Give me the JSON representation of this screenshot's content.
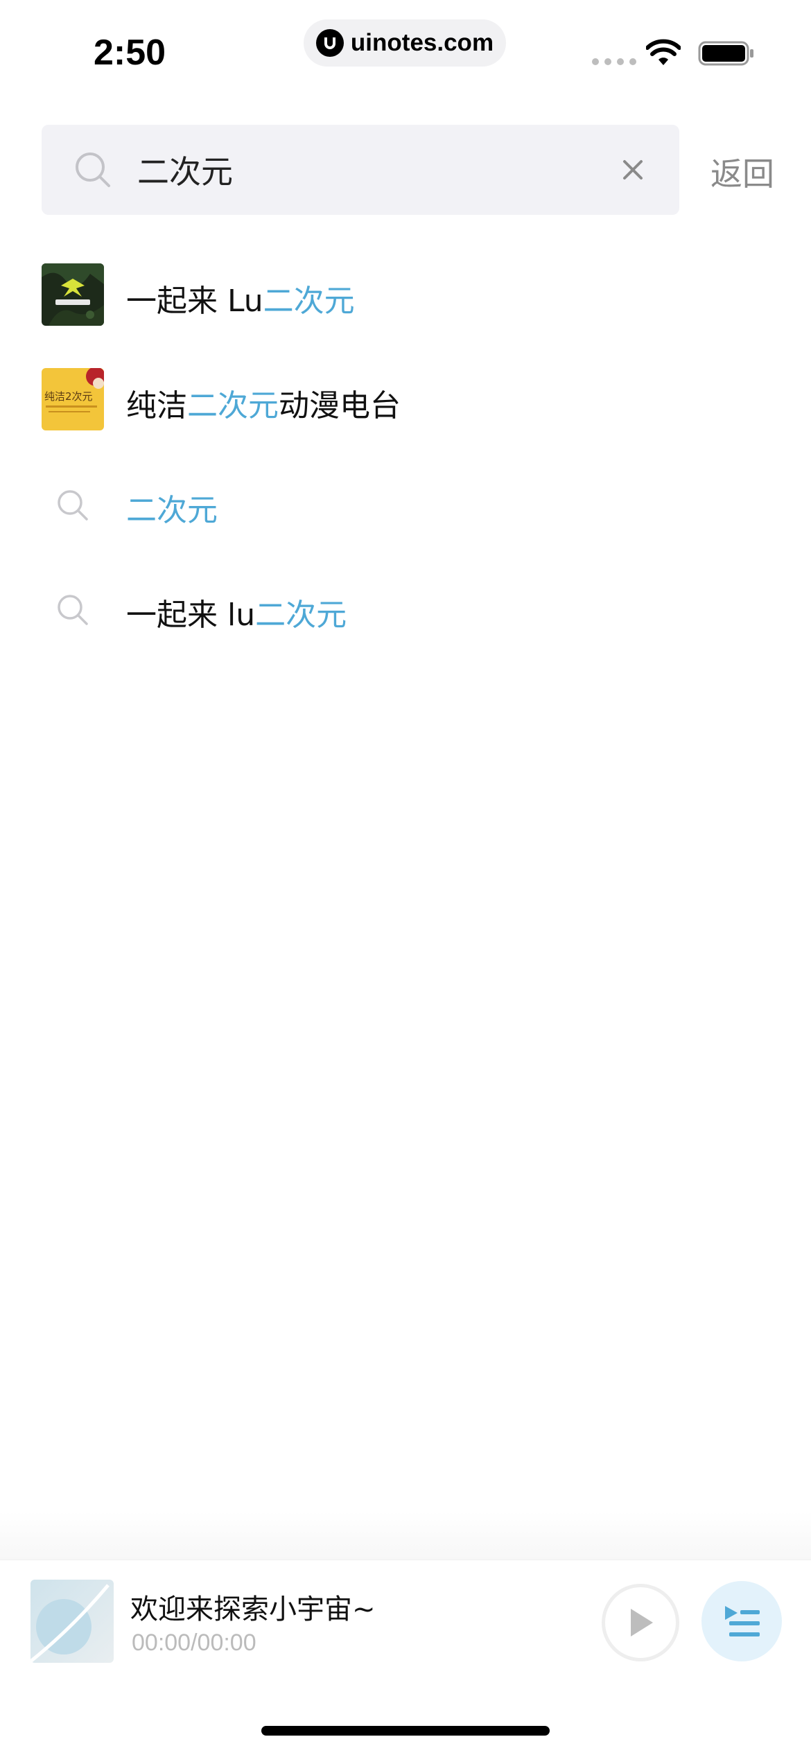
{
  "status_bar": {
    "time": "2:50",
    "url": "uinotes.com",
    "icons": [
      "signal-icon",
      "wifi-icon",
      "battery-icon"
    ]
  },
  "search": {
    "query": "二次元",
    "back_label": "返回"
  },
  "results": [
    {
      "type": "album",
      "prefix": "一起来 Lu",
      "highlight": "二次元",
      "suffix": "",
      "thumb": "album-art-green"
    },
    {
      "type": "album",
      "prefix": "纯洁",
      "highlight": "二次元",
      "suffix": "动漫电台",
      "thumb": "album-art-yellow",
      "thumb_text": "纯洁2次元"
    },
    {
      "type": "query",
      "prefix": "",
      "highlight": "二次元",
      "suffix": ""
    },
    {
      "type": "query",
      "prefix": "一起来 lu",
      "highlight": "二次元",
      "suffix": ""
    }
  ],
  "player": {
    "title": "欢迎来探索小宇宙~",
    "time": "00:00/00:00"
  },
  "colors": {
    "highlight": "#4ea8d6",
    "search_bg": "#f2f2f6",
    "secondary_text": "#8a8a8a"
  }
}
